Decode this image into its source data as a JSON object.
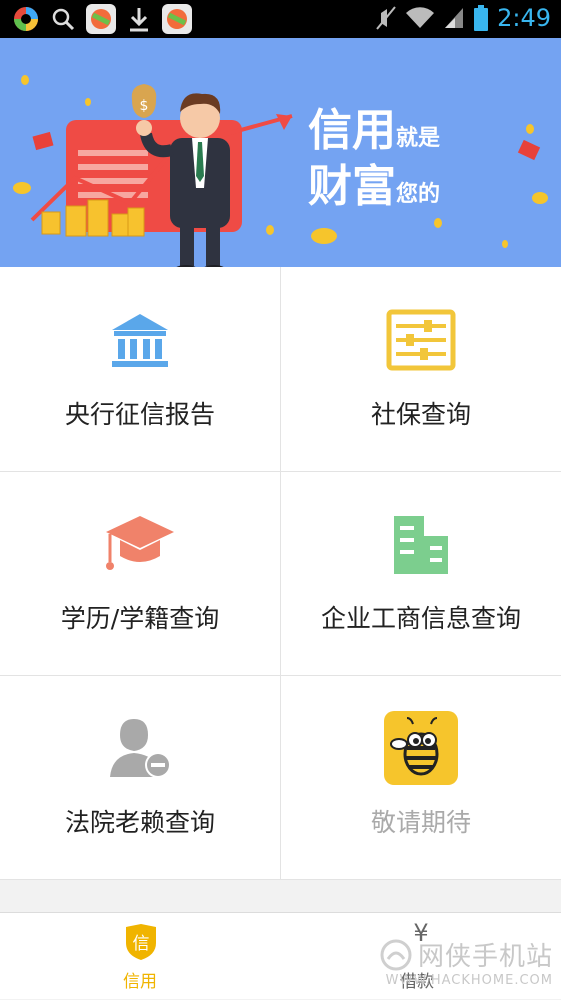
{
  "status_bar": {
    "time": "2:49",
    "icons": [
      "app-360-icon",
      "search-icon",
      "app-store-icon",
      "download-icon",
      "app-store-icon",
      "mute-icon",
      "wifi-icon",
      "signal-icon",
      "battery-icon"
    ]
  },
  "banner": {
    "line1_big": "信用",
    "line1_small": "就是",
    "line2_big": "财富",
    "line2_small": "您的",
    "color": "#74a3f2"
  },
  "grid": {
    "items": [
      {
        "label": "央行征信报告",
        "icon": "bank-icon",
        "color": "#5aa7ea"
      },
      {
        "label": "社保查询",
        "icon": "equalizer-icon",
        "color": "#f2c63a"
      },
      {
        "label": "学历/学籍查询",
        "icon": "graduation-cap-icon",
        "color": "#f0826a"
      },
      {
        "label": "企业工商信息查询",
        "icon": "building-icon",
        "color": "#7cce8e"
      },
      {
        "label": "法院老赖查询",
        "icon": "user-minus-icon",
        "color": "#a9a9a9"
      },
      {
        "label": "敬请期待",
        "icon": "bee-icon",
        "color": "#f6c52c"
      }
    ]
  },
  "tabbar": {
    "tabs": [
      {
        "label": "信用",
        "icon_text": "信",
        "active": true,
        "color": "#f0b400"
      },
      {
        "label": "借款",
        "icon_text": "¥",
        "active": false,
        "color": "#888888"
      }
    ]
  },
  "watermark": {
    "cn": "网侠手机站",
    "en": "WWW.HACKHOME.COM"
  }
}
